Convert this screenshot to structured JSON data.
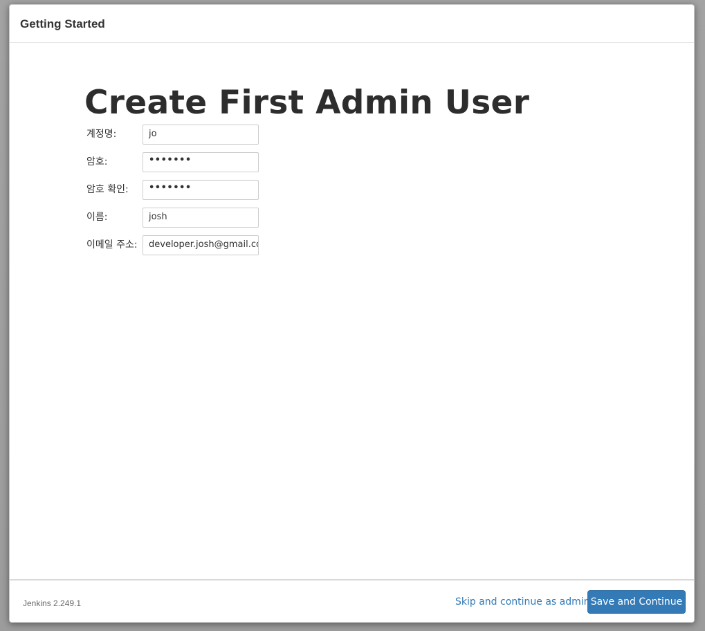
{
  "dialog": {
    "title": "Getting Started"
  },
  "main": {
    "heading": "Create First Admin User",
    "fields": [
      {
        "label": "계정명:",
        "value": "jo",
        "type": "text"
      },
      {
        "label": "암호:",
        "value": "•••••••",
        "type": "password"
      },
      {
        "label": "암호 확인:",
        "value": "•••••••",
        "type": "password"
      },
      {
        "label": "이름:",
        "value": "josh",
        "type": "text"
      },
      {
        "label": "이메일 주소:",
        "value": "developer.josh@gmail.com",
        "type": "text"
      }
    ]
  },
  "footer": {
    "version": "Jenkins 2.249.1",
    "skip_label": "Skip and continue as admin",
    "save_label": "Save and Continue"
  },
  "colors": {
    "primary": "#337ab7",
    "link": "#337ab7",
    "text": "#333333"
  }
}
